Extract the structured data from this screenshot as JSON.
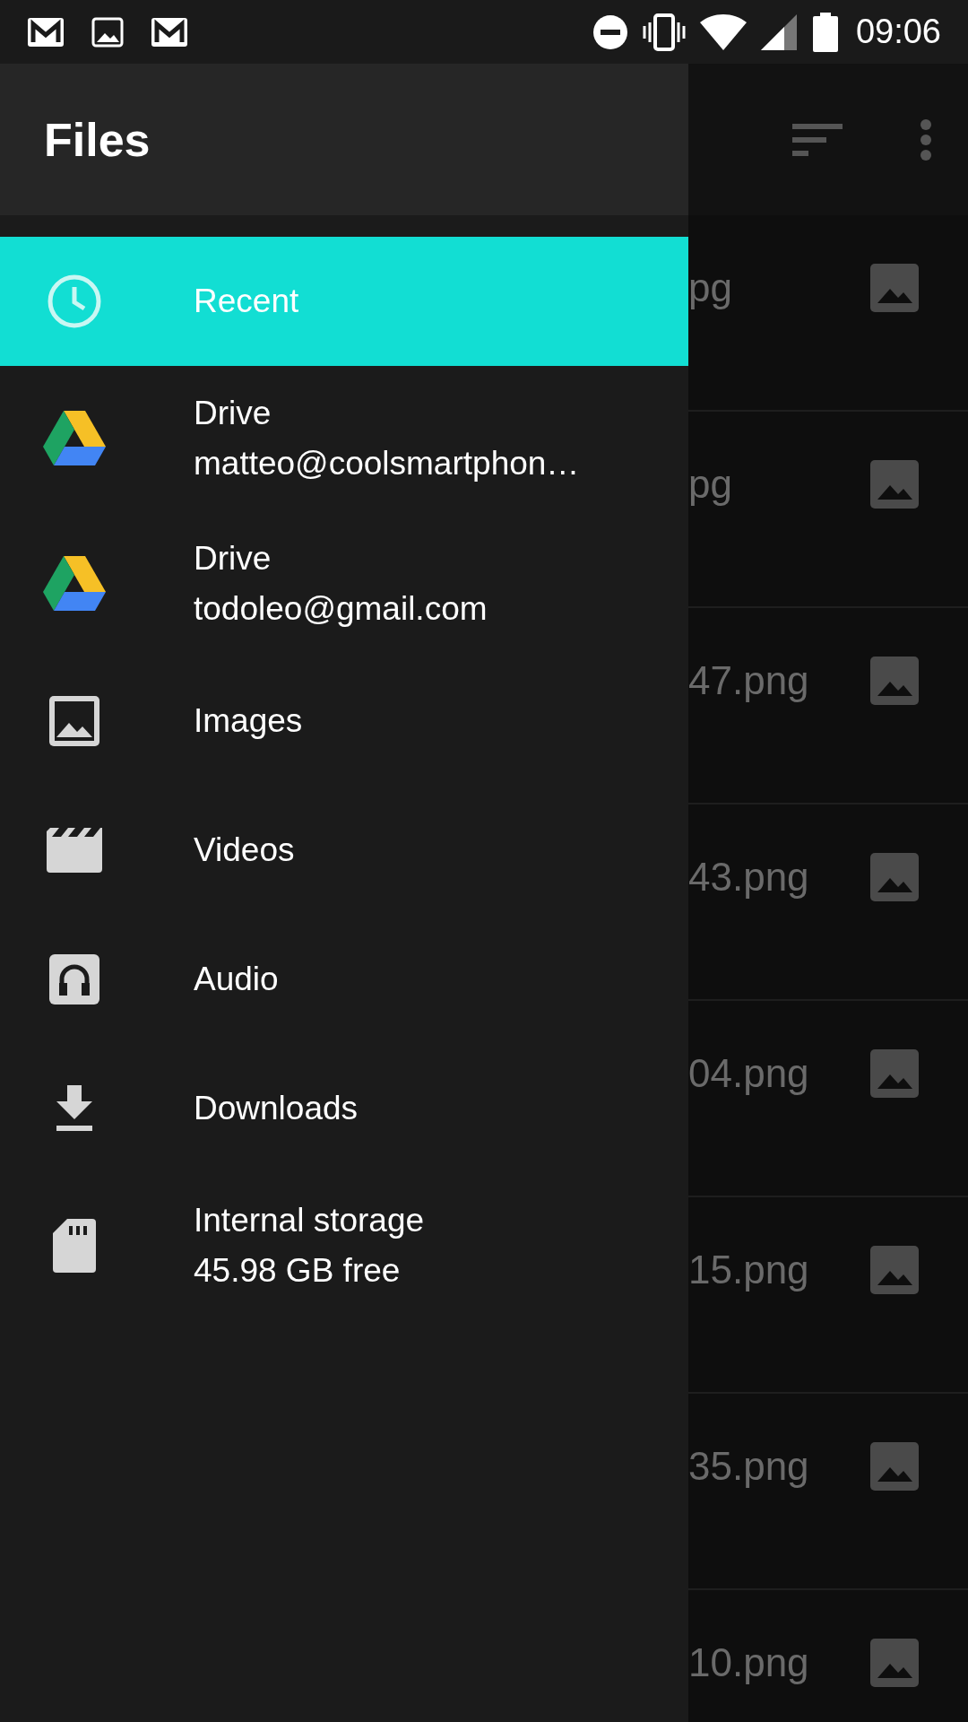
{
  "status_bar": {
    "time": "09:06"
  },
  "file_list": {
    "rows": [
      {
        "name": "pg"
      },
      {
        "name": "pg"
      },
      {
        "name": "47.png"
      },
      {
        "name": "43.png"
      },
      {
        "name": "04.png"
      },
      {
        "name": "15.png"
      },
      {
        "name": "35.png"
      },
      {
        "name": "10.png"
      }
    ]
  },
  "drawer": {
    "title": "Files",
    "items": [
      {
        "kind": "recent",
        "label": "Recent",
        "selected": true
      },
      {
        "kind": "drive",
        "label": "Drive",
        "sublabel": "matteo@coolsmartphon…",
        "selected": false
      },
      {
        "kind": "drive",
        "label": "Drive",
        "sublabel": "todoleo@gmail.com",
        "selected": false
      },
      {
        "kind": "images",
        "label": "Images",
        "selected": false
      },
      {
        "kind": "videos",
        "label": "Videos",
        "selected": false
      },
      {
        "kind": "audio",
        "label": "Audio",
        "selected": false
      },
      {
        "kind": "downloads",
        "label": "Downloads",
        "selected": false
      },
      {
        "kind": "storage",
        "label": "Internal storage",
        "sublabel": "45.98 GB free",
        "selected": false
      }
    ]
  }
}
